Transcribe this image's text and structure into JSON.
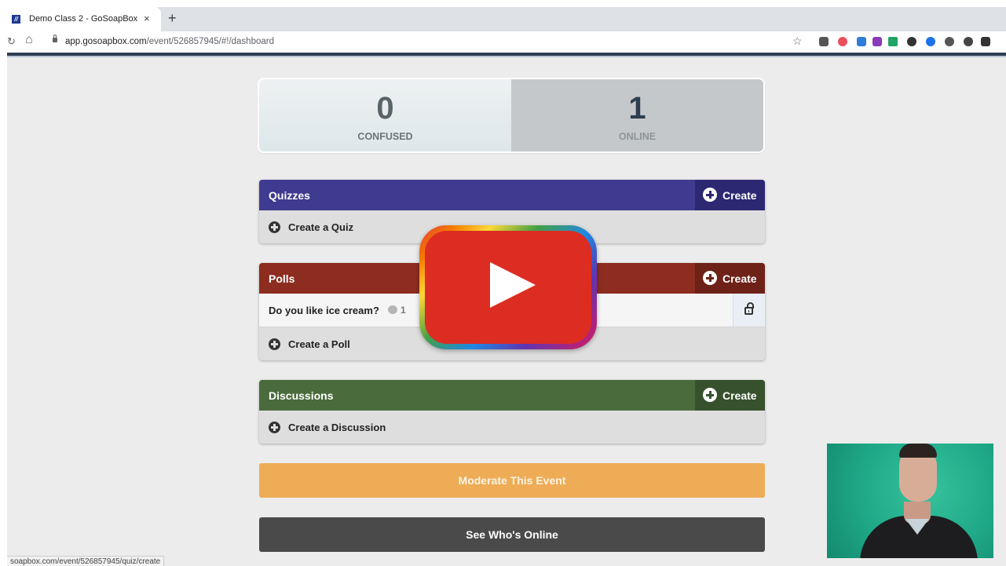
{
  "browser": {
    "tab_title": "Demo Class 2 - GoSoapBox",
    "tab_close": "×",
    "new_tab": "+",
    "url_host": "app.gosoapbox.com",
    "url_path": "/event/526857945/#!/dashboard",
    "status_url": "soapbox.com/event/526857945/quiz/create"
  },
  "stats": {
    "confused_count": "0",
    "confused_label": "CONFUSED",
    "online_count": "1",
    "online_label": "ONLINE"
  },
  "quizzes": {
    "title": "Quizzes",
    "create_label": "Create",
    "create_row": "Create a Quiz"
  },
  "polls": {
    "title": "Polls",
    "create_label": "Create",
    "items": [
      {
        "question": "Do you like ice cream?",
        "responses": "1"
      }
    ],
    "create_row": "Create a Poll"
  },
  "discussions": {
    "title": "Discussions",
    "create_label": "Create",
    "create_row": "Create a Discussion"
  },
  "buttons": {
    "moderate": "Moderate This Event",
    "whos_online": "See Who's Online"
  },
  "colors": {
    "quizzes": "#3f3b90",
    "polls": "#8c2d20",
    "discussions": "#4a6b3c",
    "moderate": "#eeac56",
    "whos_online": "#4a4a4a"
  },
  "icons": [
    "reload-icon",
    "home-icon",
    "lock-icon",
    "star-icon",
    "play-icon",
    "comment-bubble-icon",
    "unlock-icon",
    "plus-circle-icon"
  ]
}
